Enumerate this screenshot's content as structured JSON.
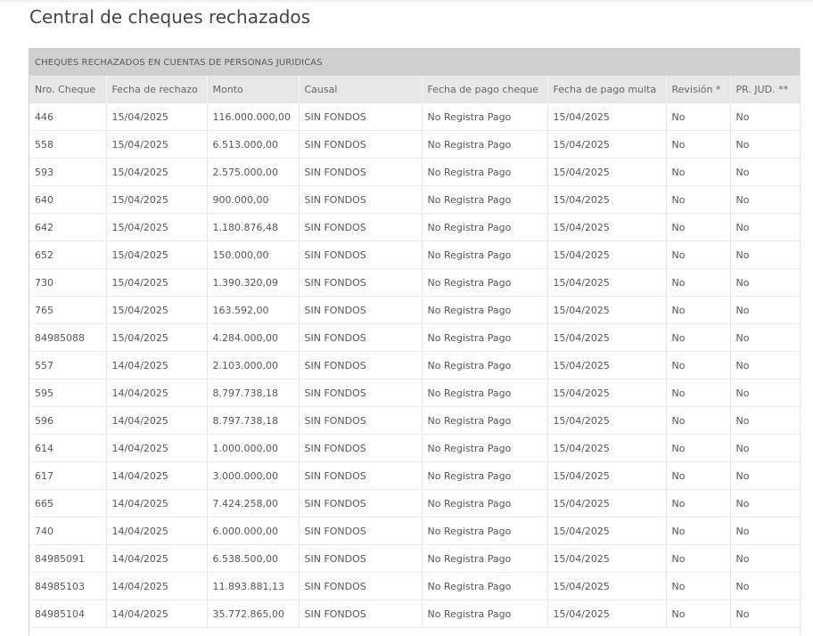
{
  "page": {
    "title": "Central de cheques rechazados"
  },
  "table": {
    "caption": "CHEQUES RECHAZADOS EN CUENTAS DE PERSONAS JURIDICAS",
    "columns": [
      "Nro. Cheque",
      "Fecha de rechazo",
      "Monto",
      "Causal",
      "Fecha de pago cheque",
      "Fecha de pago multa",
      "Revisión *",
      "PR. JUD. **"
    ],
    "rows": [
      [
        "446",
        "15/04/2025",
        "116.000.000,00",
        "SIN FONDOS",
        "No Registra Pago",
        "15/04/2025",
        "No",
        "No"
      ],
      [
        "558",
        "15/04/2025",
        "6.513.000,00",
        "SIN FONDOS",
        "No Registra Pago",
        "15/04/2025",
        "No",
        "No"
      ],
      [
        "593",
        "15/04/2025",
        "2.575.000,00",
        "SIN FONDOS",
        "No Registra Pago",
        "15/04/2025",
        "No",
        "No"
      ],
      [
        "640",
        "15/04/2025",
        "900.000,00",
        "SIN FONDOS",
        "No Registra Pago",
        "15/04/2025",
        "No",
        "No"
      ],
      [
        "642",
        "15/04/2025",
        "1.180.876,48",
        "SIN FONDOS",
        "No Registra Pago",
        "15/04/2025",
        "No",
        "No"
      ],
      [
        "652",
        "15/04/2025",
        "150.000,00",
        "SIN FONDOS",
        "No Registra Pago",
        "15/04/2025",
        "No",
        "No"
      ],
      [
        "730",
        "15/04/2025",
        "1.390.320,09",
        "SIN FONDOS",
        "No Registra Pago",
        "15/04/2025",
        "No",
        "No"
      ],
      [
        "765",
        "15/04/2025",
        "163.592,00",
        "SIN FONDOS",
        "No Registra Pago",
        "15/04/2025",
        "No",
        "No"
      ],
      [
        "84985088",
        "15/04/2025",
        "4.284.000,00",
        "SIN FONDOS",
        "No Registra Pago",
        "15/04/2025",
        "No",
        "No"
      ],
      [
        "557",
        "14/04/2025",
        "2.103.000,00",
        "SIN FONDOS",
        "No Registra Pago",
        "15/04/2025",
        "No",
        "No"
      ],
      [
        "595",
        "14/04/2025",
        "8.797.738,18",
        "SIN FONDOS",
        "No Registra Pago",
        "15/04/2025",
        "No",
        "No"
      ],
      [
        "596",
        "14/04/2025",
        "8.797.738,18",
        "SIN FONDOS",
        "No Registra Pago",
        "15/04/2025",
        "No",
        "No"
      ],
      [
        "614",
        "14/04/2025",
        "1.000.000,00",
        "SIN FONDOS",
        "No Registra Pago",
        "15/04/2025",
        "No",
        "No"
      ],
      [
        "617",
        "14/04/2025",
        "3.000.000,00",
        "SIN FONDOS",
        "No Registra Pago",
        "15/04/2025",
        "No",
        "No"
      ],
      [
        "665",
        "14/04/2025",
        "7.424.258,00",
        "SIN FONDOS",
        "No Registra Pago",
        "15/04/2025",
        "No",
        "No"
      ],
      [
        "740",
        "14/04/2025",
        "6.000.000,00",
        "SIN FONDOS",
        "No Registra Pago",
        "15/04/2025",
        "No",
        "No"
      ],
      [
        "84985091",
        "14/04/2025",
        "6.538.500,00",
        "SIN FONDOS",
        "No Registra Pago",
        "15/04/2025",
        "No",
        "No"
      ],
      [
        "84985103",
        "14/04/2025",
        "11.893.881,13",
        "SIN FONDOS",
        "No Registra Pago",
        "15/04/2025",
        "No",
        "No"
      ],
      [
        "84985104",
        "14/04/2025",
        "35.772.865,00",
        "SIN FONDOS",
        "No Registra Pago",
        "15/04/2025",
        "No",
        "No"
      ]
    ]
  }
}
